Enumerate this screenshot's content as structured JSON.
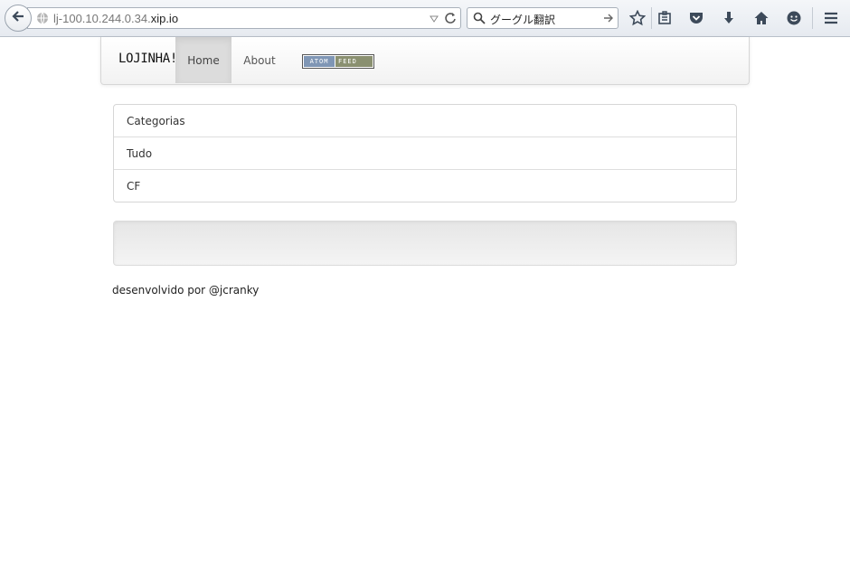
{
  "browser": {
    "url_prefix": "lj-100.10.244.0.34.",
    "url_domain": "xip.io",
    "search_text": "グーグル翻訳",
    "icons": [
      "back-arrow-icon",
      "globe-icon",
      "dropdown-triangle-icon",
      "reload-icon",
      "search-icon",
      "go-arrow-icon",
      "bookmark-star-icon",
      "reading-list-icon",
      "pocket-icon",
      "download-icon",
      "home-icon",
      "smiley-icon",
      "menu-icon"
    ]
  },
  "navbar": {
    "brand": "LOJINHA!",
    "items": [
      {
        "label": "Home",
        "active": true
      },
      {
        "label": "About",
        "active": false
      }
    ],
    "feed_badge": {
      "left": "ATOM",
      "right": "FEED"
    }
  },
  "categories": {
    "items": [
      "Categorias",
      "Tudo",
      "CF"
    ]
  },
  "footer": {
    "text": "desenvolvido por @jcranky"
  },
  "colors": {
    "active_nav_bg": "#dcdcdc",
    "feed_atom": "#7f96b5",
    "feed_label": "#8a9070"
  }
}
